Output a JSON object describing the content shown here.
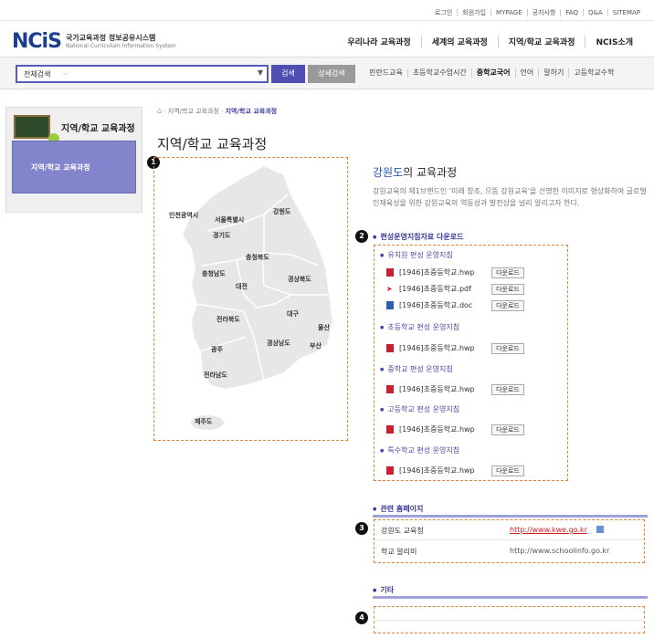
{
  "util_links": [
    "로그인",
    "회원가입",
    "MYPAGE",
    "공지사항",
    "FAQ",
    "Q&A",
    "SITEMAP"
  ],
  "logo": {
    "mark": "NCiS",
    "kr": "국가교육과정 정보공유시스템",
    "en": "National Curriculum Information System"
  },
  "gnb": [
    "우리나라 교육과정",
    "세계의 교육과정",
    "지역/학교 교육과정",
    "NCIS소개"
  ],
  "search": {
    "scope": "전체검색",
    "search_label": "검색",
    "detail_label": "상세검색"
  },
  "quick_links": [
    {
      "label": "핀란드교육",
      "active": false
    },
    {
      "label": "초등학교수업시간",
      "active": false
    },
    {
      "label": "중학교국어",
      "active": true
    },
    {
      "label": "언어",
      "active": false
    },
    {
      "label": "말하기",
      "active": false
    },
    {
      "label": "고등학교수학",
      "active": false
    }
  ],
  "sidebar": {
    "title": "지역/학교 교육과정",
    "item": "지역/학교 교육과정"
  },
  "breadcrumb": {
    "home": "⌂",
    "parent": "지역/학교 교육과정",
    "current": "지역/학교 교육과정"
  },
  "page_title": "지역/학교 교육과정",
  "markers": [
    "1",
    "2",
    "3",
    "4"
  ],
  "map_regions": [
    "인천광역시",
    "서울특별시",
    "강원도",
    "경기도",
    "충청북도",
    "충청남도",
    "대전",
    "경상북도",
    "대구",
    "전라북도",
    "울산",
    "광주",
    "경상남도",
    "부산",
    "전라남도",
    "제주도"
  ],
  "province": {
    "name": "강원도",
    "suffix": "의 교육과정",
    "desc": "강원교육의 제1브랜드인 '미래 창조, 으뜸 강원교육'을 선명한 이미지로 형상화하여 글로벌 인재육성을 위한 강원교육의 역동성과 발전상을 널리 알리고자 한다."
  },
  "downloads": {
    "title": "편성운영지침자료 다운로드",
    "button_label": "다운로드",
    "categories": [
      {
        "label": "유치원 편성 운영지침",
        "files": [
          {
            "name": "[1946]초중등학교.hwp",
            "type": "hwp"
          },
          {
            "name": "[1946]초중등학교.pdf",
            "type": "pdf"
          },
          {
            "name": "[1946]초중등학교.doc",
            "type": "doc"
          }
        ]
      },
      {
        "label": "초등학교 편성 운영지침",
        "files": [
          {
            "name": "[1946]초중등학교.hwp",
            "type": "hwp"
          }
        ]
      },
      {
        "label": "중학교 편성 운영지침",
        "files": [
          {
            "name": "[1946]초중등학교.hwp",
            "type": "hwp"
          }
        ]
      },
      {
        "label": "고등학교 편성 운영지침",
        "files": [
          {
            "name": "[1946]초중등학교.hwp",
            "type": "hwp"
          }
        ]
      },
      {
        "label": "특수학교 편성 운영지침",
        "files": [
          {
            "name": "[1946]초중등학교.hwp",
            "type": "hwp"
          }
        ]
      }
    ]
  },
  "related": {
    "title": "관련 홈페이지",
    "rows": [
      {
        "name": "강원도 교육청",
        "url": "http://www.kwe.go.kr"
      },
      {
        "name": "학교 알리미",
        "url": "http://www.schoolinfo.go.kr"
      }
    ]
  },
  "etc": {
    "title": "기타"
  },
  "colors": {
    "accent": "#4d4fb3",
    "dashed_border": "#e0843d",
    "link_red": "#d02020"
  }
}
